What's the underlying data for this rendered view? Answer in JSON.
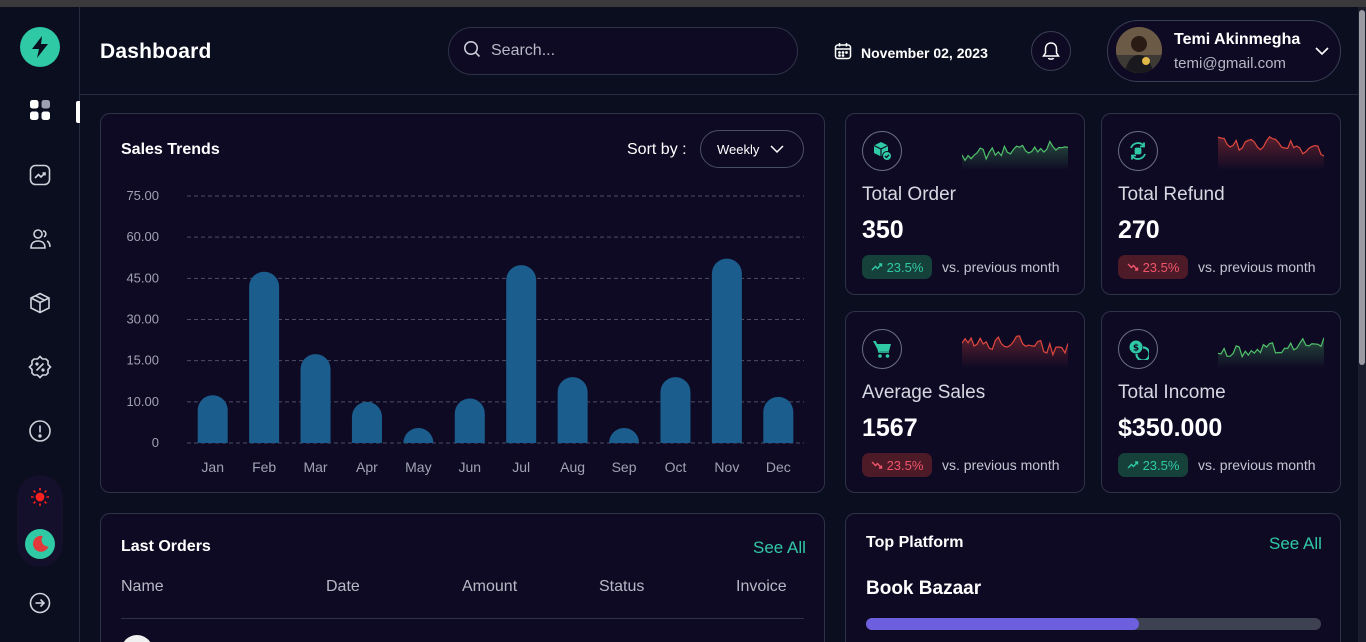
{
  "header": {
    "title": "Dashboard",
    "search_placeholder": "Search...",
    "date": "November 02, 2023",
    "user": {
      "name": "Temi Akinmegha",
      "email": "temi@gmail.com"
    }
  },
  "sidebar": {
    "items": [
      {
        "icon": "dashboard-grid-icon",
        "active": true
      },
      {
        "icon": "trend-chart-icon"
      },
      {
        "icon": "users-icon"
      },
      {
        "icon": "box-icon"
      },
      {
        "icon": "discount-badge-icon"
      },
      {
        "icon": "info-alert-icon"
      }
    ],
    "theme": {
      "light": "sun-icon",
      "dark": "moon-icon",
      "selected": "dark"
    },
    "logout": "logout-arrow-icon"
  },
  "sales": {
    "title": "Sales Trends",
    "sort_label": "Sort by :",
    "sort_value": "Weekly"
  },
  "chart_data": {
    "type": "bar",
    "title": "Sales Trends",
    "categories": [
      "Jan",
      "Feb",
      "Mar",
      "Apr",
      "May",
      "Jun",
      "Jul",
      "Aug",
      "Sep",
      "Oct",
      "Nov",
      "Dec"
    ],
    "values": [
      14.5,
      52,
      27,
      12.5,
      2.5,
      13.5,
      54,
      20,
      4,
      20,
      56,
      14
    ],
    "y_ticks": [
      "75.00",
      "60.00",
      "45.00",
      "30.00",
      "15.00",
      "10.00",
      "0"
    ],
    "ylim": [
      0,
      75
    ],
    "grid": true,
    "colors": {
      "bar": "#1b5d8c"
    }
  },
  "stats": [
    {
      "label": "Total Order",
      "value": "350",
      "change": "23.5%",
      "trend": "up",
      "vs": "vs. previous month",
      "icon": "package-check-icon",
      "spark_color": "#4fc16a"
    },
    {
      "label": "Total Refund",
      "value": "270",
      "change": "23.5%",
      "trend": "down",
      "vs": "vs. previous month",
      "icon": "refund-cycle-icon",
      "spark_color": "#e0483e"
    },
    {
      "label": "Average Sales",
      "value": "1567",
      "change": "23.5%",
      "trend": "down",
      "vs": "vs. previous month",
      "icon": "shopping-cart-icon",
      "spark_color": "#e0483e"
    },
    {
      "label": "Total Income",
      "value": "$350.000",
      "change": "23.5%",
      "trend": "up",
      "vs": "vs. previous month",
      "icon": "coins-icon",
      "spark_color": "#4fc16a"
    }
  ],
  "orders": {
    "title": "Last Orders",
    "see_all": "See All",
    "columns": [
      "Name",
      "Date",
      "Amount",
      "Status",
      "Invoice"
    ]
  },
  "platform": {
    "title": "Top Platform",
    "see_all": "See All",
    "items": [
      {
        "name": "Book Bazaar",
        "progress": 0.6
      }
    ]
  },
  "colors": {
    "accent": "#30c9a5",
    "negative": "#f0556b",
    "card_bg": "#0f0a24",
    "page_bg": "#0b0e1f"
  }
}
